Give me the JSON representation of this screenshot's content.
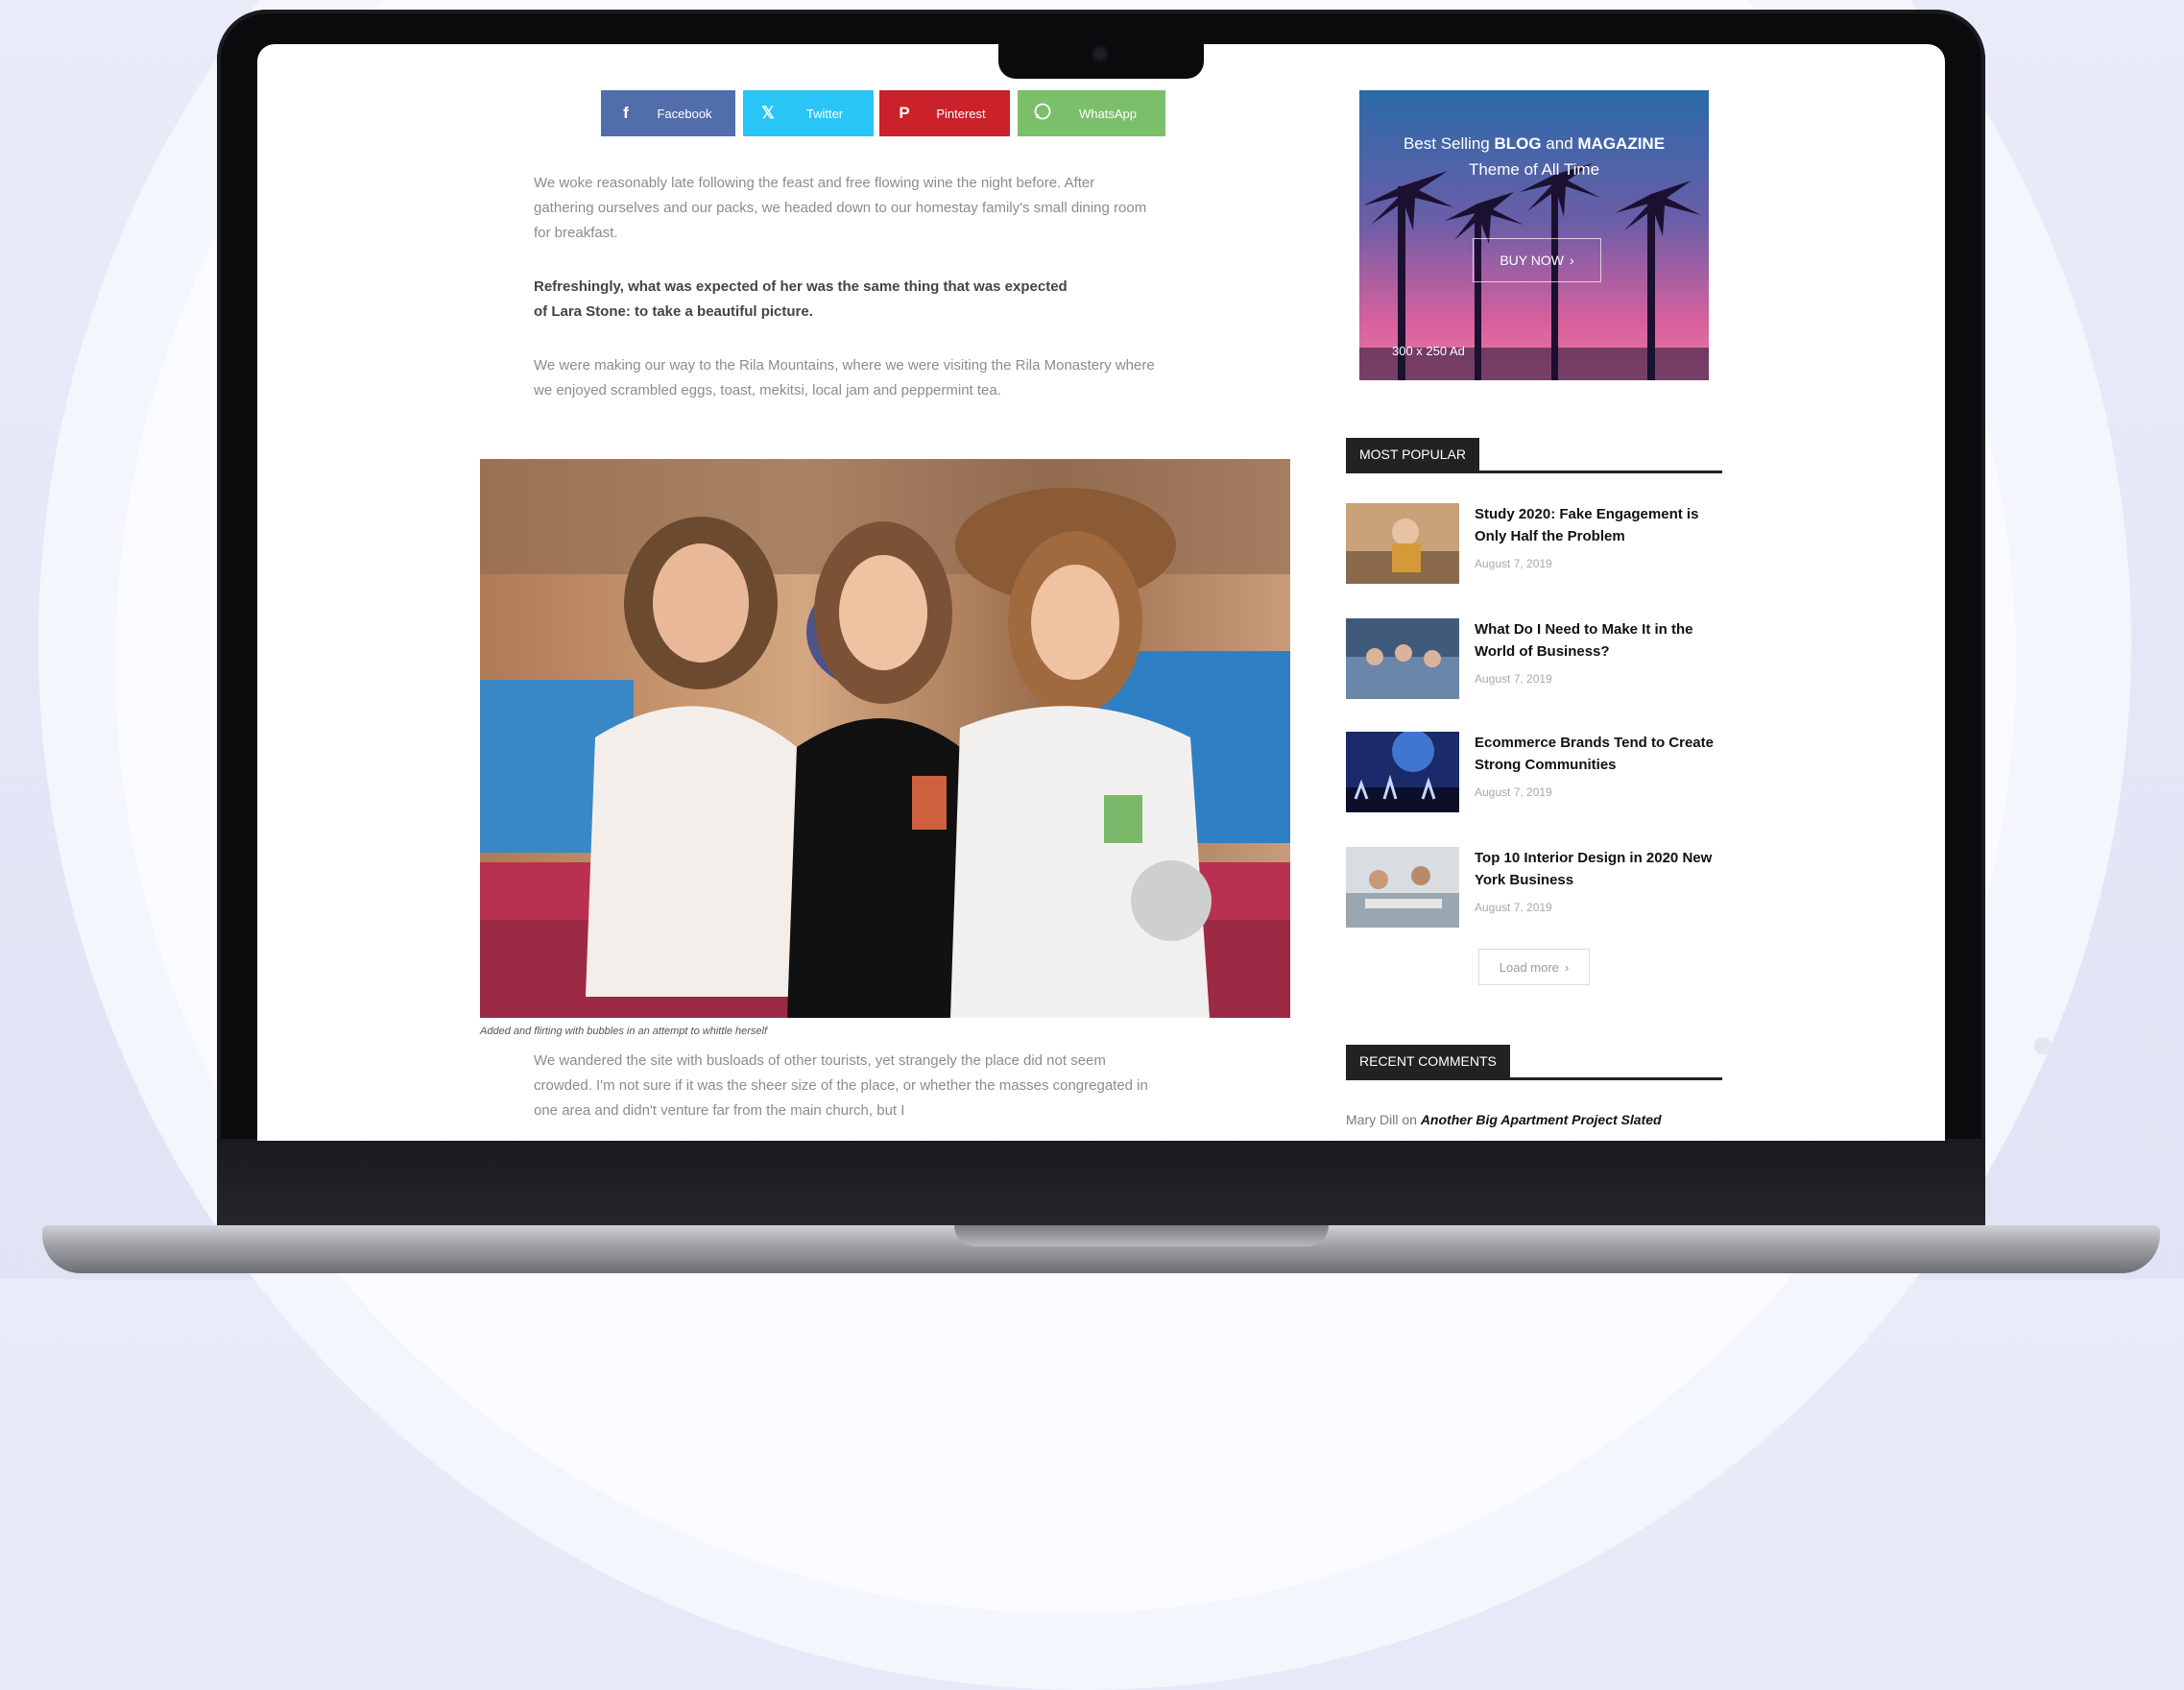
{
  "share": {
    "facebook": "Facebook",
    "twitter": "Twitter",
    "pinterest": "Pinterest",
    "whatsapp": "WhatsApp"
  },
  "article": {
    "p1": "We woke reasonably late following the feast and free flowing wine the night before. After gathering ourselves and our packs, we headed down to our homestay family's small dining room for breakfast.",
    "p2": "Refreshingly, what was expected of her was the same thing that was expected of Lara Stone: to take a beautiful picture.",
    "p3": "We were making our way to the Rila Mountains, where we were visiting the Rila Monastery where we enjoyed scrambled eggs, toast, mekitsi, local jam and peppermint tea.",
    "caption": "Added and flirting with bubbles in an attempt to whittle herself",
    "p4": "We wandered the site with busloads of other tourists, yet strangely the place did not seem crowded. I'm not sure if it was the sheer size of the place, or whether the masses congregated in one area and didn't venture far from the main church, but I"
  },
  "ad": {
    "line1_pre": "Best Selling ",
    "line1_b1": "BLOG",
    "line1_mid": " and ",
    "line1_b2": "MAGAZINE",
    "line2": "Theme of All Time",
    "button": "BUY NOW",
    "size": "300 x 250 Ad"
  },
  "most_popular": {
    "heading": "MOST POPULAR",
    "items": [
      {
        "title": "Study 2020: Fake Engagement is Only Half the Problem",
        "date": "August 7, 2019"
      },
      {
        "title": "What Do I Need to Make It in the World of Business?",
        "date": "August 7, 2019"
      },
      {
        "title": "Ecommerce Brands Tend to Create Strong Communities",
        "date": "August 7, 2019"
      },
      {
        "title": "Top 10 Interior Design in 2020 New York Business",
        "date": "August 7, 2019"
      }
    ],
    "load_more": "Load more"
  },
  "recent_comments": {
    "heading": "RECENT COMMENTS",
    "author": "Mary Dill",
    "on": " on ",
    "post": "Another Big Apartment Project Slated"
  },
  "icons": {
    "facebook": "facebook-icon",
    "twitter": "x-icon",
    "pinterest": "pinterest-icon",
    "whatsapp": "whatsapp-icon"
  },
  "colors": {
    "facebook": "#516eab",
    "twitter": "#29c5f6",
    "pinterest": "#ca212a",
    "whatsapp": "#7bbf6a"
  }
}
